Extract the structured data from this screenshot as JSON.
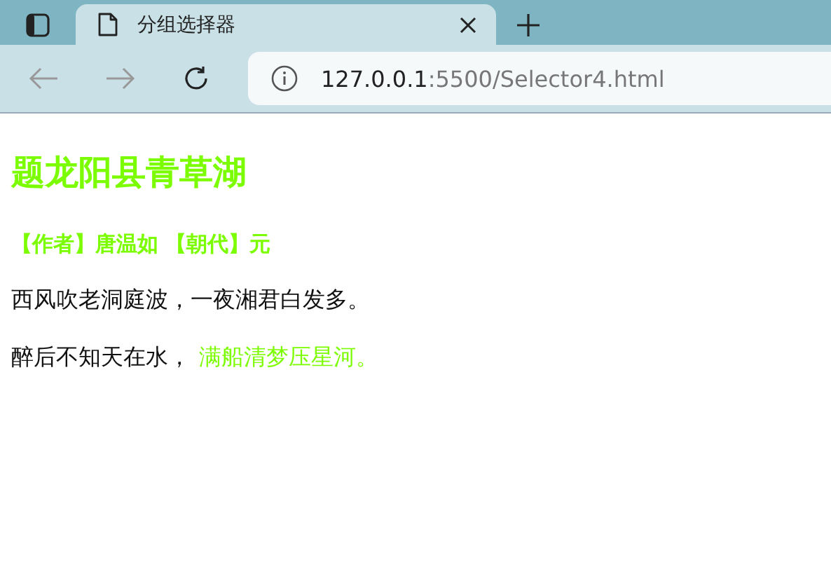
{
  "browser": {
    "tab": {
      "title": "分组选择器",
      "selected": true
    },
    "address": {
      "host": "127.0.0.1",
      "path": ":5500/Selector4.html"
    }
  },
  "page": {
    "title": "题龙阳县青草湖",
    "byline": "【作者】唐温如 【朝代】元",
    "lines": [
      {
        "segments": [
          {
            "text": "西风吹老洞庭波，一夜湘君白发多。",
            "highlight": false
          }
        ]
      },
      {
        "segments": [
          {
            "text": "醉后不知天在水，",
            "highlight": false
          },
          {
            "text": "满船清梦压星河。",
            "highlight": true
          }
        ]
      }
    ]
  }
}
